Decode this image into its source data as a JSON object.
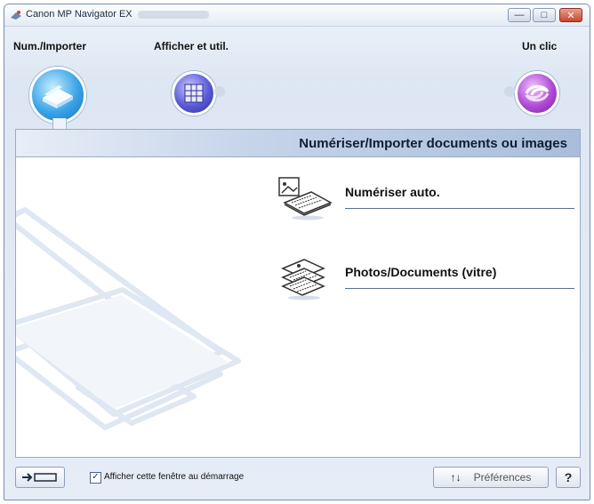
{
  "window": {
    "title": "Canon MP Navigator EX"
  },
  "tabs": [
    {
      "label": "Num./Importer",
      "icon": "scanner-icon"
    },
    {
      "label": "Afficher et util.",
      "icon": "grid-icon"
    },
    {
      "label": "Un clic",
      "icon": "one-click-icon"
    }
  ],
  "panel": {
    "title": "Numériser/Importer documents ou images",
    "actions": [
      {
        "label": "Numériser auto."
      },
      {
        "label": "Photos/Documents (vitre)"
      }
    ]
  },
  "footer": {
    "show_window_label": "Afficher cette fenêtre au démarrage",
    "show_window_checked": true,
    "preferences_label": "Préférences",
    "help_label": "?"
  },
  "colors": {
    "accent_blue": "#3aa4e6",
    "accent_purple": "#5a5ad8",
    "accent_magenta": "#b04ad6"
  }
}
